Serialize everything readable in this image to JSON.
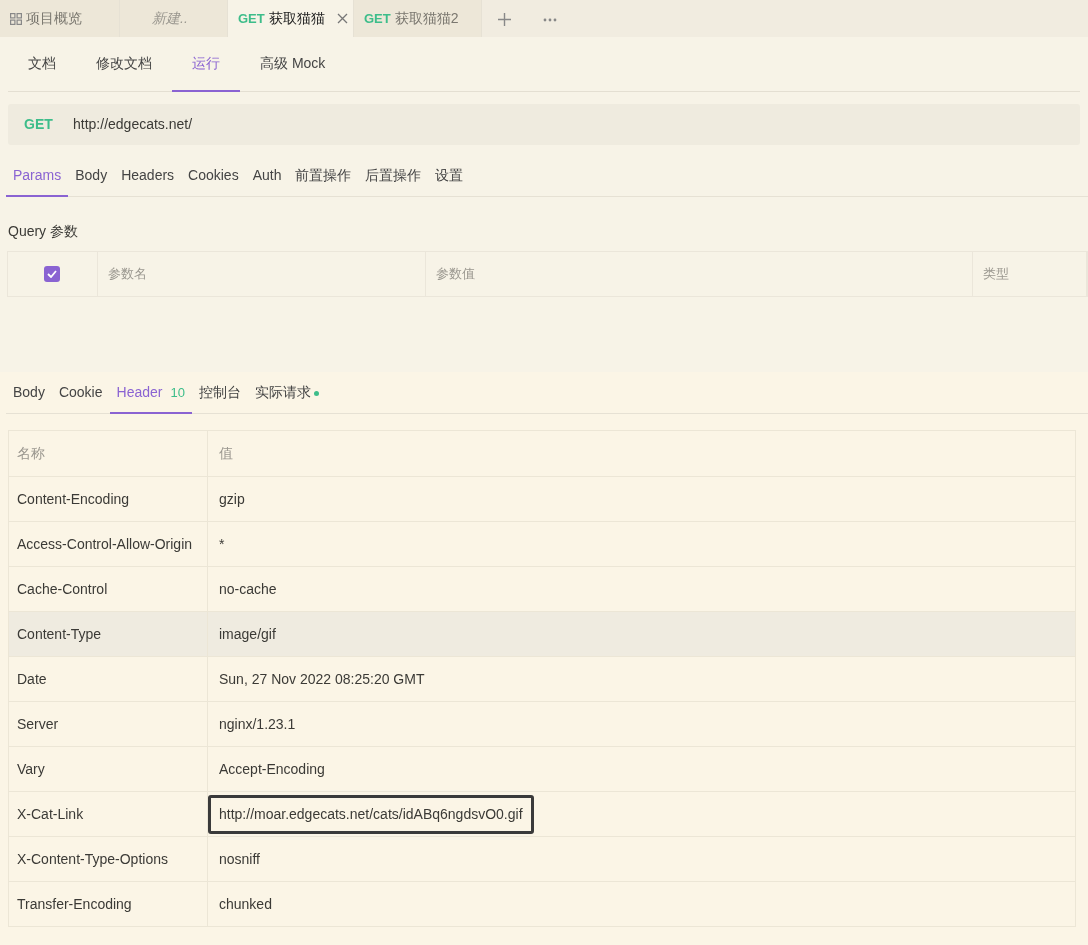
{
  "file_tabs": [
    {
      "kind": "overview",
      "label": "项目概览",
      "selected": false
    },
    {
      "kind": "draft",
      "label": "新建..",
      "selected": false
    },
    {
      "kind": "request",
      "method": "GET",
      "label": "获取猫猫",
      "selected": true
    },
    {
      "kind": "request",
      "method": "GET",
      "label": "获取猫猫2",
      "selected": false
    }
  ],
  "view_tabs": [
    {
      "label": "文档",
      "selected": false
    },
    {
      "label": "修改文档",
      "selected": false
    },
    {
      "label": "运行",
      "selected": true
    },
    {
      "label": "高级 Mock",
      "selected": false
    }
  ],
  "request": {
    "method": "GET",
    "url": "http://edgecats.net/"
  },
  "request_tabs": [
    {
      "label": "Params",
      "selected": true
    },
    {
      "label": "Body",
      "selected": false
    },
    {
      "label": "Headers",
      "selected": false
    },
    {
      "label": "Cookies",
      "selected": false
    },
    {
      "label": "Auth",
      "selected": false
    },
    {
      "label": "前置操作",
      "selected": false
    },
    {
      "label": "后置操作",
      "selected": false
    },
    {
      "label": "设置",
      "selected": false
    }
  ],
  "query": {
    "title": "Query 参数",
    "all_checked": true,
    "columns": [
      "参数名",
      "参数值",
      "类型"
    ]
  },
  "response_tabs": [
    {
      "label": "Body",
      "selected": false
    },
    {
      "label": "Cookie",
      "selected": false
    },
    {
      "label": "Header",
      "count": "10",
      "selected": true
    },
    {
      "label": "控制台",
      "selected": false
    },
    {
      "label": "实际请求",
      "dot": true,
      "selected": false
    }
  ],
  "headers": {
    "columns": [
      "名称",
      "值"
    ],
    "rows": [
      {
        "name": "Content-Encoding",
        "value": "gzip",
        "highlighted": false,
        "outlined": false
      },
      {
        "name": "Access-Control-Allow-Origin",
        "value": "*",
        "highlighted": false,
        "outlined": false
      },
      {
        "name": "Cache-Control",
        "value": "no-cache",
        "highlighted": false,
        "outlined": false
      },
      {
        "name": "Content-Type",
        "value": "image/gif",
        "highlighted": true,
        "outlined": false
      },
      {
        "name": "Date",
        "value": "Sun, 27 Nov 2022 08:25:20 GMT",
        "highlighted": false,
        "outlined": false
      },
      {
        "name": "Server",
        "value": "nginx/1.23.1",
        "highlighted": false,
        "outlined": false
      },
      {
        "name": "Vary",
        "value": "Accept-Encoding",
        "highlighted": false,
        "outlined": false
      },
      {
        "name": "X-Cat-Link",
        "value": "http://moar.edgecats.net/cats/idABq6ngdsvO0.gif",
        "highlighted": false,
        "outlined": true
      },
      {
        "name": "X-Content-Type-Options",
        "value": "nosniff",
        "highlighted": false,
        "outlined": false
      },
      {
        "name": "Transfer-Encoding",
        "value": "chunked",
        "highlighted": false,
        "outlined": false
      }
    ]
  }
}
